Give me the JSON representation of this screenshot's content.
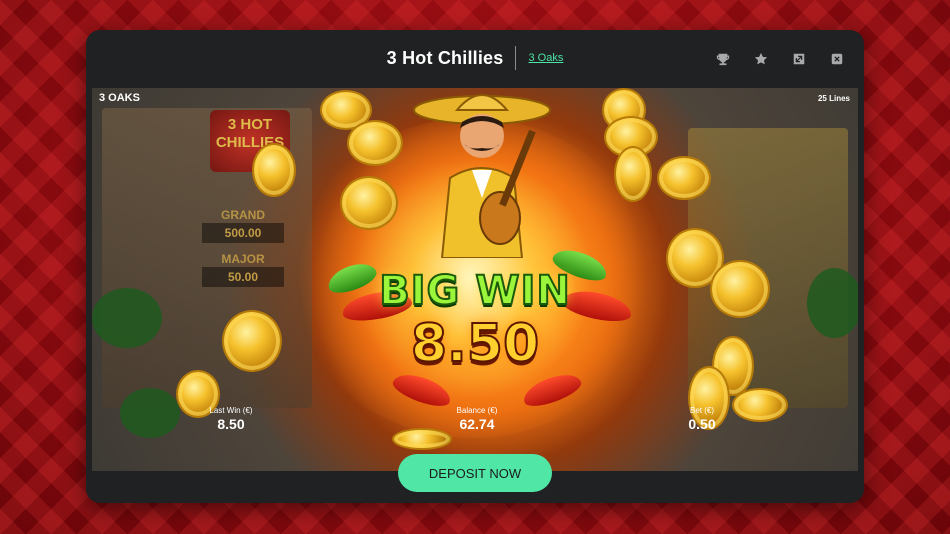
{
  "header": {
    "title": "3 Hot Chillies",
    "provider_link": "3 Oaks",
    "icons": [
      "trophy-icon",
      "star-icon",
      "expand-icon",
      "close-icon"
    ]
  },
  "game": {
    "brand_tag": "3 OAKS",
    "lines_tag": "25 Lines",
    "logo_text": "3 HOT CHILLIES",
    "jackpots": [
      {
        "name": "GRAND",
        "value": "500.00"
      },
      {
        "name": "MAJOR",
        "value": "50.00"
      }
    ],
    "big_win_label": "BIG WIN",
    "big_win_amount": "8.50",
    "stats": {
      "last_win_label": "Last Win (€)",
      "last_win_value": "8.50",
      "balance_label": "Balance (€)",
      "balance_value": "62.74",
      "bet_label": "Bet (€)",
      "bet_value": "0.50"
    }
  },
  "footer": {
    "deposit_label": "DEPOSIT NOW"
  },
  "colors": {
    "accent": "#4fe6a6",
    "modal_bg": "#1f2122",
    "page_bg": "#a70f15"
  }
}
